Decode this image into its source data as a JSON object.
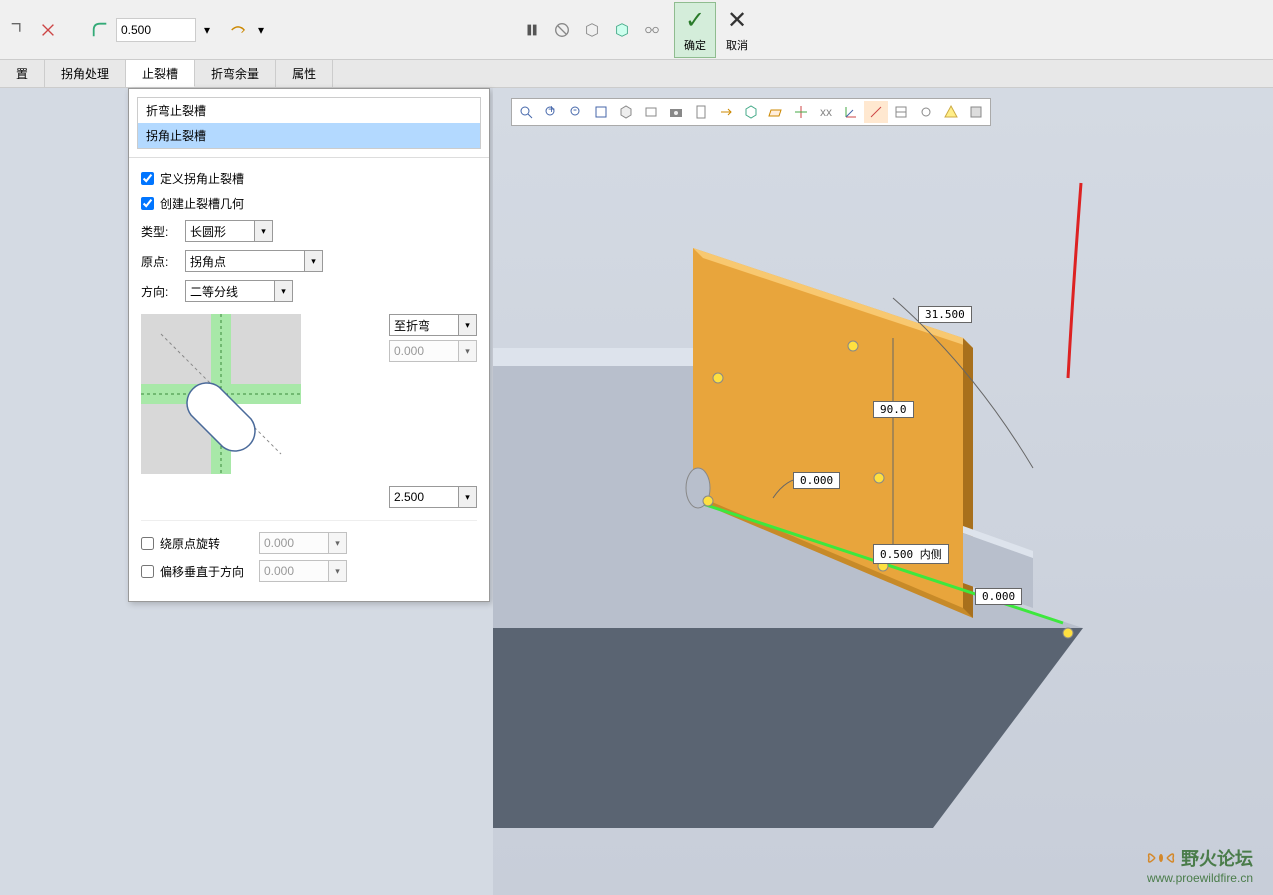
{
  "toolbar": {
    "value_input": "0.500",
    "confirm_label": "确定",
    "cancel_label": "取消"
  },
  "tabs": {
    "items": [
      "置",
      "拐角处理",
      "止裂槽",
      "折弯余量",
      "属性"
    ],
    "active_index": 2
  },
  "panel": {
    "list_items": [
      "折弯止裂槽",
      "拐角止裂槽"
    ],
    "selected_list_index": 1,
    "checkbox_define": "定义拐角止裂槽",
    "checkbox_define_checked": true,
    "checkbox_create": "创建止裂槽几何",
    "checkbox_create_checked": true,
    "type_label": "类型:",
    "type_value": "长圆形",
    "origin_label": "原点:",
    "origin_value": "拐角点",
    "direction_label": "方向:",
    "direction_value": "二等分线",
    "extent_value": "至折弯",
    "offset_value": "0.000",
    "slot_value": "2.500",
    "rotate_label": "绕原点旋转",
    "rotate_value": "0.000",
    "offset_perp_label": "偏移垂直于方向",
    "offset_perp_value": "0.000"
  },
  "dimensions": {
    "d1": "31.500",
    "d2": "90.0",
    "d3": "0.000",
    "d4": "0.500 内侧",
    "d5": "0.000"
  },
  "watermark": {
    "cn": "野火论坛",
    "en": "www.proewildfire.cn"
  }
}
